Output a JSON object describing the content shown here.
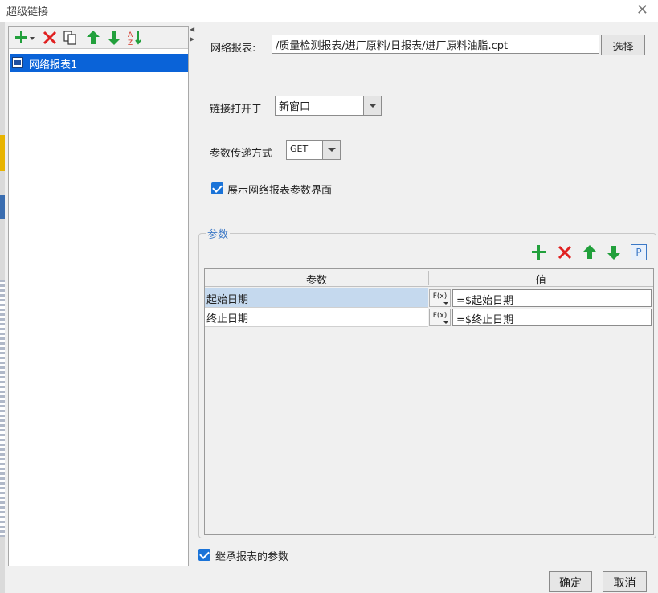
{
  "window": {
    "title": "超级链接"
  },
  "left": {
    "tree": [
      {
        "label": "网络报表1"
      }
    ]
  },
  "form": {
    "report_label": "网络报表:",
    "report_path": "/质量检测报表/进厂原料/日报表/进厂原料油脂.cpt",
    "choose_button": "选择",
    "open_in_label": "链接打开于",
    "open_in_value": "新窗口",
    "method_label": "参数传递方式",
    "method_value": "GET",
    "show_params_label": "展示网络报表参数界面"
  },
  "params": {
    "legend": "参数",
    "col_name": "参数",
    "col_value": "值",
    "fx_label": "F(x)",
    "p_button": "P",
    "rows": [
      {
        "name": "起始日期",
        "value": "=$起始日期"
      },
      {
        "name": "终止日期",
        "value": "=$终止日期"
      }
    ]
  },
  "inherit_label": "继承报表的参数",
  "footer": {
    "ok": "确定",
    "cancel": "取消"
  },
  "colors": {
    "accent": "#1a73d8",
    "selection": "#0a63d8",
    "add": "#22a03c",
    "delete": "#e02020"
  }
}
